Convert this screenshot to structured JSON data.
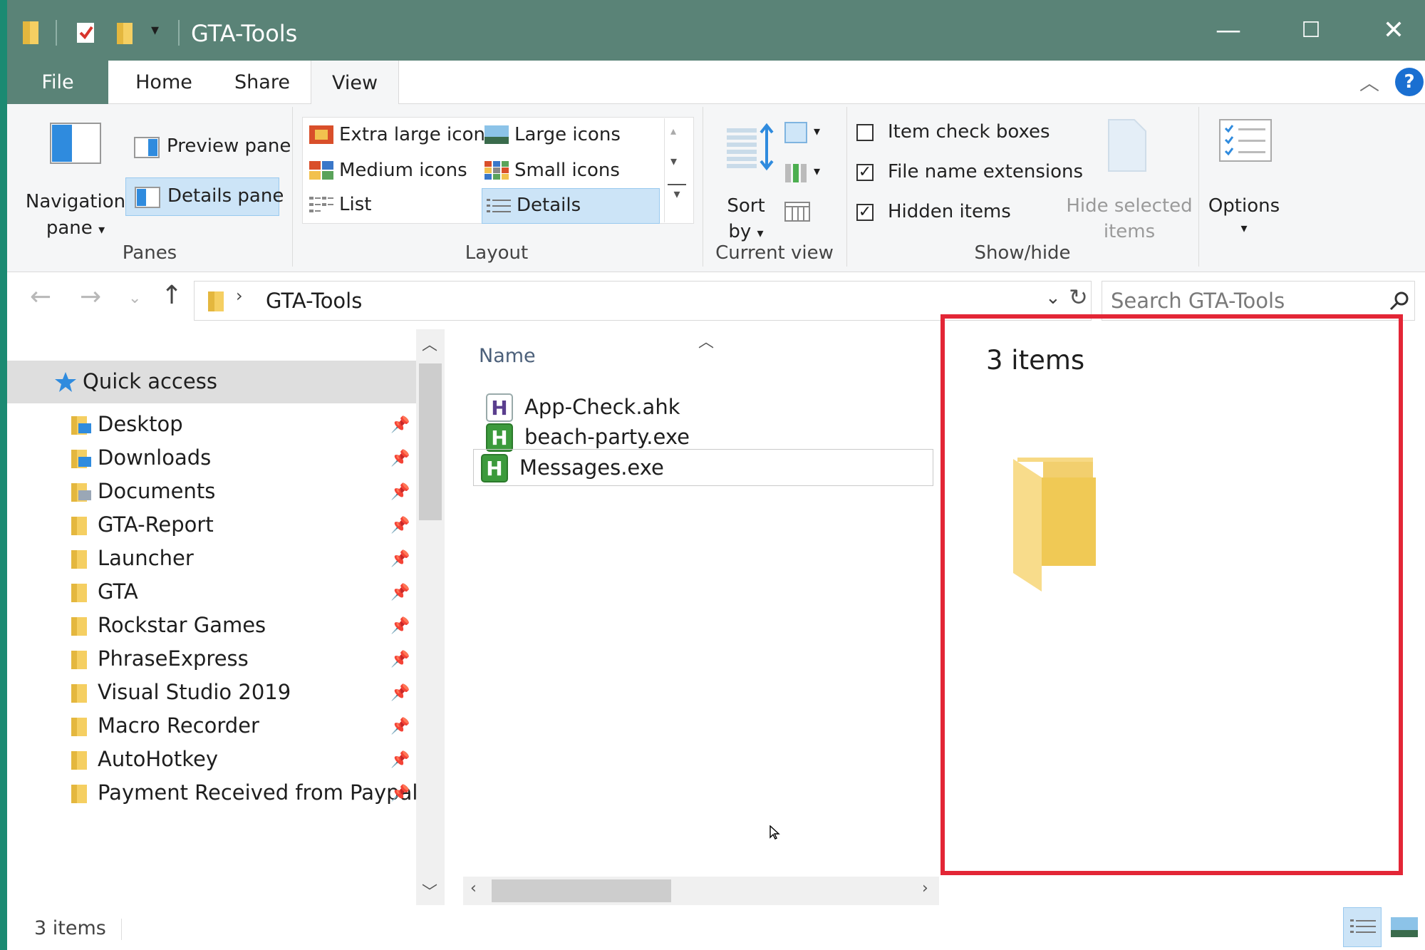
{
  "window": {
    "title": "GTA-Tools",
    "accent_color": "#5a8377",
    "controls": {
      "minimize": "—",
      "maximize": "☐",
      "close": "✕"
    }
  },
  "ribbon_tabs": [
    "File",
    "Home",
    "Share",
    "View"
  ],
  "ribbon": {
    "panes": {
      "navigation_pane_line1": "Navigation",
      "navigation_pane_line2": "pane",
      "preview_pane": "Preview pane",
      "details_pane": "Details pane",
      "group_label": "Panes"
    },
    "layout": {
      "extra_large_icons": "Extra large icons",
      "large_icons": "Large icons",
      "medium_icons": "Medium icons",
      "small_icons": "Small icons",
      "list": "List",
      "details": "Details",
      "group_label": "Layout"
    },
    "current_view": {
      "sort_line1": "Sort",
      "sort_line2": "by",
      "group_label": "Current view"
    },
    "show_hide": {
      "item_check_boxes": "Item check boxes",
      "file_name_extensions": "File name extensions",
      "hidden_items": "Hidden items",
      "hide_selected_line1": "Hide selected",
      "hide_selected_line2": "items",
      "group_label": "Show/hide",
      "checked": {
        "item_check_boxes": false,
        "file_name_extensions": true,
        "hidden_items": true
      }
    },
    "options_label": "Options"
  },
  "address": {
    "path_segment": "GTA-Tools",
    "search_placeholder": "Search GTA-Tools"
  },
  "nav": {
    "quick_access": "Quick access",
    "items": [
      "Desktop",
      "Downloads",
      "Documents",
      "GTA-Report",
      "Launcher",
      "GTA",
      "Rockstar Games",
      "PhraseExpress",
      "Visual Studio 2019",
      "Macro Recorder",
      "AutoHotkey",
      "Payment Received from Paypal"
    ]
  },
  "filelist": {
    "column_name": "Name",
    "files": [
      {
        "name": "App-Check.ahk",
        "icon": "ahk-script-icon"
      },
      {
        "name": "beach-party.exe",
        "icon": "autohotkey-exe-icon"
      },
      {
        "name": "Messages.exe",
        "icon": "autohotkey-exe-icon"
      }
    ]
  },
  "details_pane": {
    "item_count": "3 items",
    "highlight_color": "#e32636"
  },
  "status": {
    "item_count": "3 items"
  }
}
